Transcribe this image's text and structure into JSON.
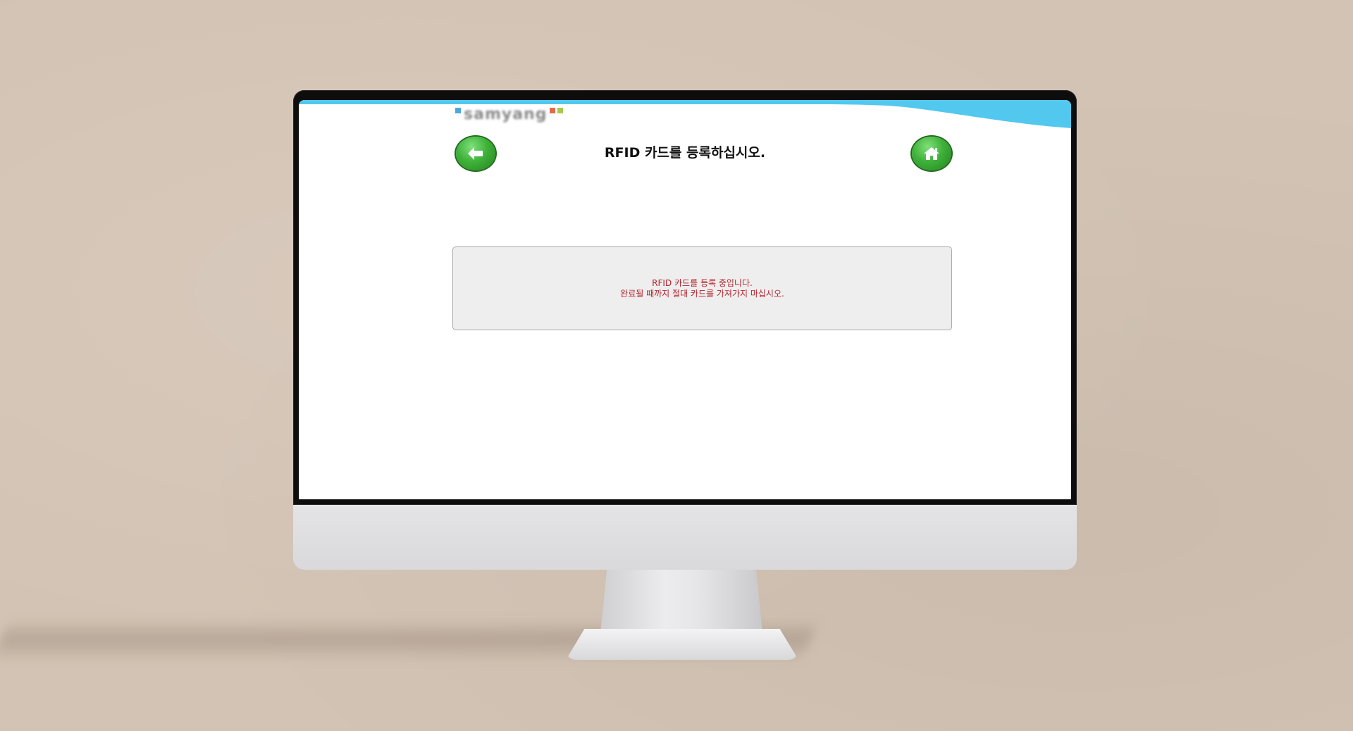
{
  "app": {
    "logo_text": "samyang"
  },
  "header": {
    "title": "RFID 카드를 등록하십시오.",
    "back_icon": "arrow-left-icon",
    "home_icon": "home-icon"
  },
  "status": {
    "line1": "RFID 카드를 등록 중입니다.",
    "line2": "완료될 때까지 절대 카드를 가져가지 마십시오.",
    "color": "#b3222c"
  },
  "colors": {
    "accent_wave": "#52c8ee",
    "button_green": "#3fb23a",
    "logo_square_blue": "#4aa8e0",
    "logo_square_red": "#e06b4a",
    "logo_square_green": "#a7c94a"
  }
}
